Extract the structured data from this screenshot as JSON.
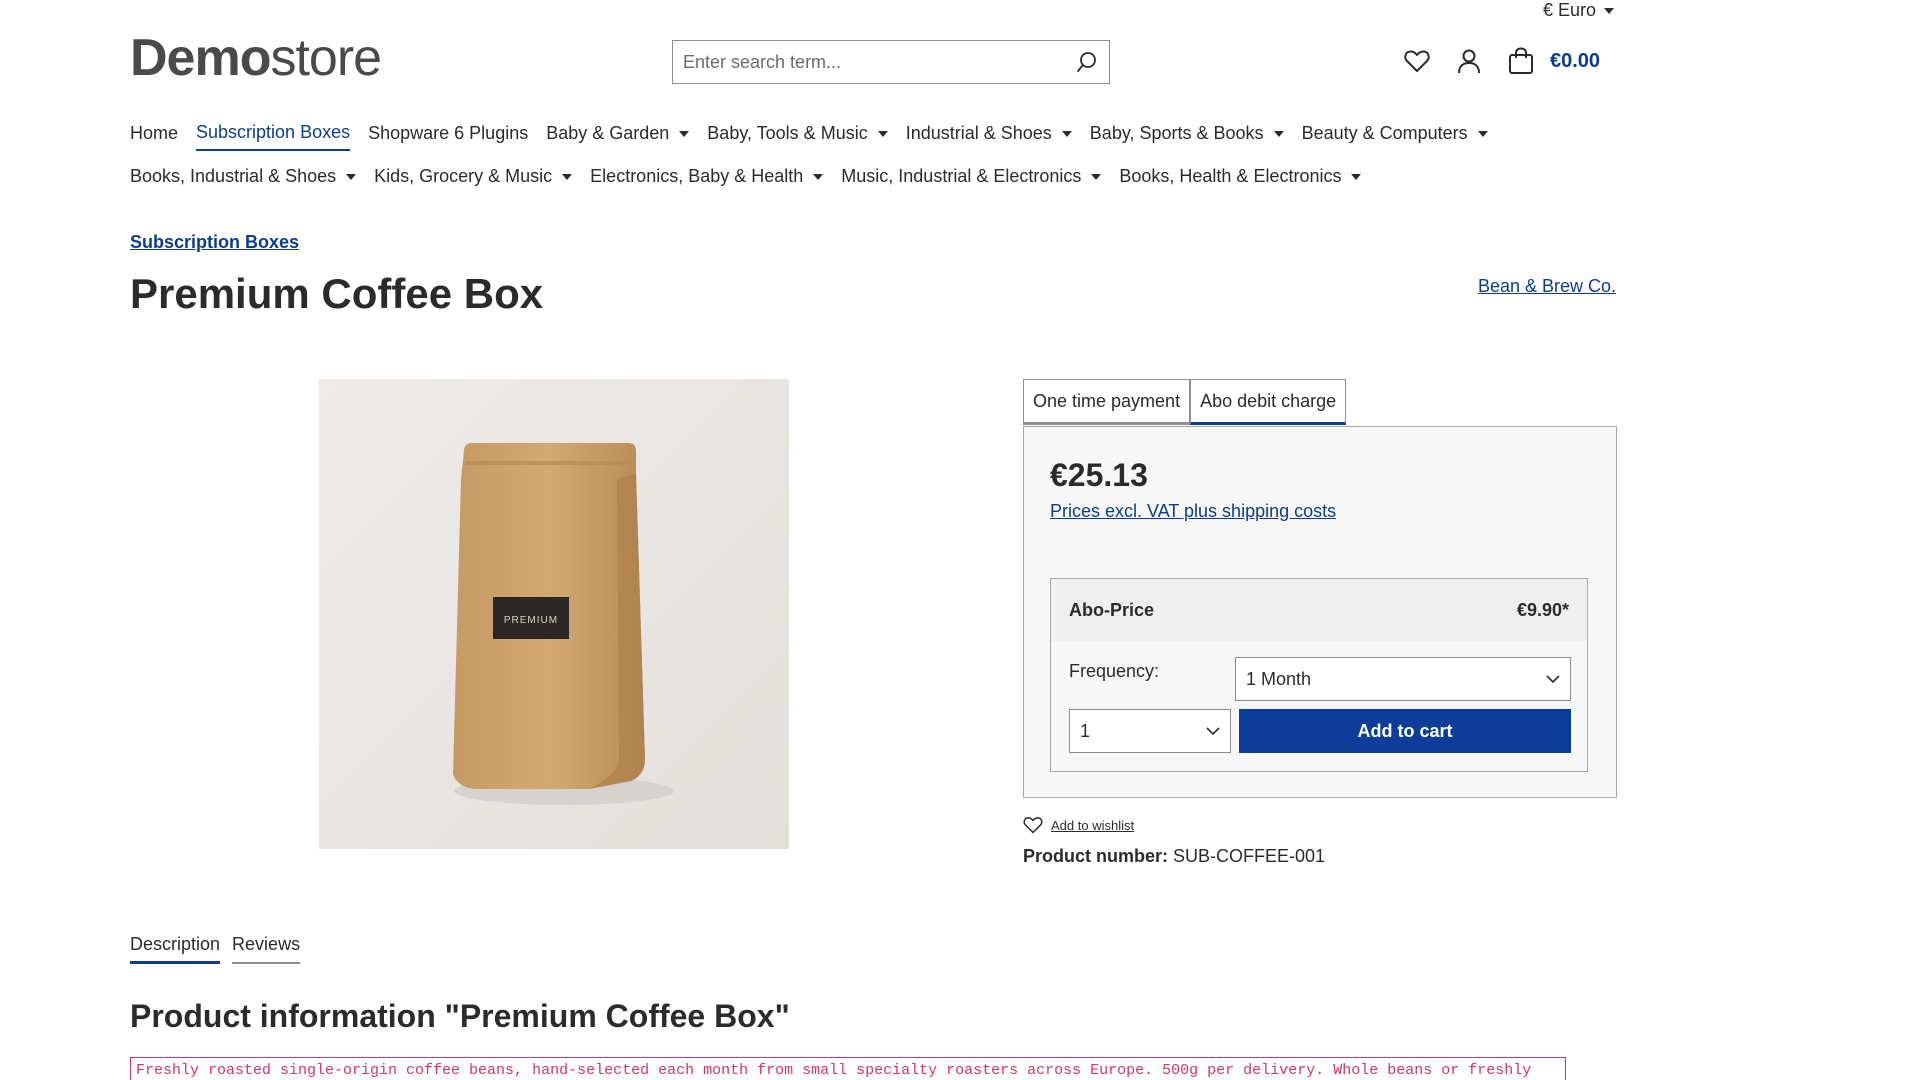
{
  "header": {
    "currency": "€ Euro",
    "logo_bold": "Demo",
    "logo_light": "store",
    "search_placeholder": "Enter search term...",
    "cart_total": "€0.00",
    "icons": [
      "search-icon",
      "heart-icon",
      "user-icon",
      "bag-icon",
      "caret-down-icon"
    ]
  },
  "nav": {
    "row1": [
      {
        "label": "Home",
        "dropdown": false,
        "active": false
      },
      {
        "label": "Subscription Boxes",
        "dropdown": false,
        "active": true
      },
      {
        "label": "Shopware 6 Plugins",
        "dropdown": false,
        "active": false
      },
      {
        "label": "Baby & Garden",
        "dropdown": true,
        "active": false
      },
      {
        "label": "Baby, Tools & Music",
        "dropdown": true,
        "active": false
      },
      {
        "label": "Industrial & Shoes",
        "dropdown": true,
        "active": false
      },
      {
        "label": "Baby, Sports & Books",
        "dropdown": true,
        "active": false
      },
      {
        "label": "Beauty & Computers",
        "dropdown": true,
        "active": false
      }
    ],
    "row2": [
      {
        "label": "Books, Industrial & Shoes",
        "dropdown": true
      },
      {
        "label": "Kids, Grocery & Music",
        "dropdown": true
      },
      {
        "label": "Electronics, Baby & Health",
        "dropdown": true
      },
      {
        "label": "Music, Industrial & Electronics",
        "dropdown": true
      },
      {
        "label": "Books, Health & Electronics",
        "dropdown": true
      }
    ]
  },
  "product": {
    "breadcrumb": "Subscription Boxes",
    "title": "Premium Coffee Box",
    "manufacturer": "Bean & Brew Co.",
    "image_label": "PREMIUM",
    "purchase_tabs": [
      "One time payment",
      "Abo debit charge"
    ],
    "price": "€25.13",
    "vat_note": "Prices excl. VAT plus shipping costs",
    "abo": {
      "label": "Abo-Price",
      "price": "€9.90*",
      "frequency_label": "Frequency:",
      "frequency_value": "1 Month",
      "quantity_value": "1",
      "add_to_cart": "Add to cart"
    },
    "wishlist": "Add to wishlist",
    "product_number_label": "Product number:",
    "product_number": "SUB-COFFEE-001"
  },
  "details": {
    "tabs": [
      "Description",
      "Reviews"
    ],
    "info_title": "Product information \"Premium Coffee Box\"",
    "description": "Freshly roasted single-origin coffee beans, hand-selected each month from small specialty roasters across Europe. 500g per delivery. Whole beans or freshly ground - your choice."
  },
  "colors": {
    "accent": "#0b3d8c",
    "button": "#0b3d99",
    "code_text": "#d6336c"
  }
}
